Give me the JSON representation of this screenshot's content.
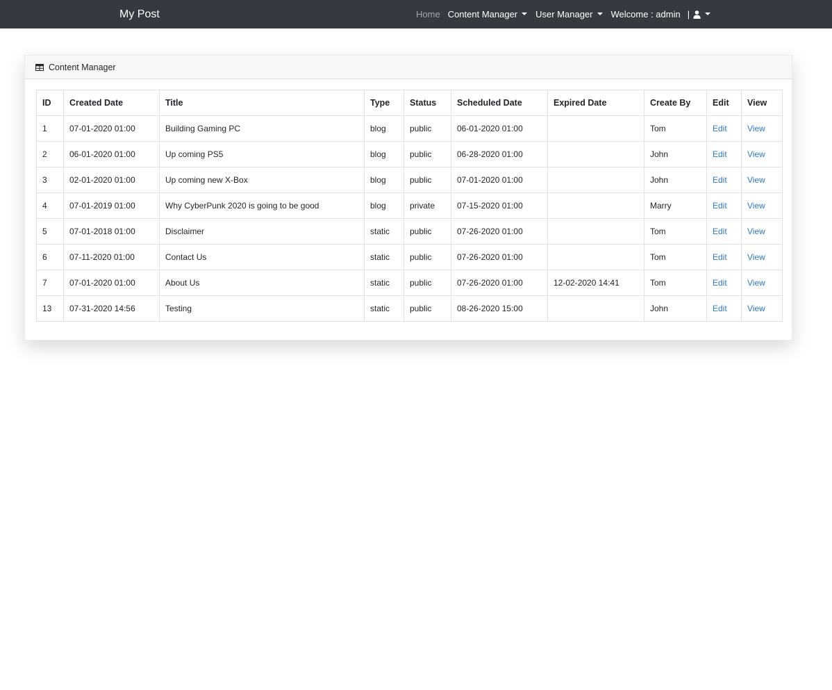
{
  "navbar": {
    "brand": "My Post",
    "home": "Home",
    "content_manager": "Content Manager",
    "user_manager": "User Manager",
    "welcome": "Welcome : admin",
    "separator": "|"
  },
  "card": {
    "title": "Content Manager"
  },
  "table": {
    "columns": [
      "ID",
      "Created Date",
      "Title",
      "Type",
      "Status",
      "Scheduled Date",
      "Expired Date",
      "Create By",
      "Edit",
      "View"
    ],
    "rows": [
      {
        "id": "1",
        "created": "07-01-2020 01:00",
        "title": "Building Gaming PC",
        "type": "blog",
        "status": "public",
        "scheduled": "06-01-2020 01:00",
        "expired": "",
        "by": "Tom",
        "edit": "Edit",
        "view": "View"
      },
      {
        "id": "2",
        "created": "06-01-2020 01:00",
        "title": "Up coming PS5",
        "type": "blog",
        "status": "public",
        "scheduled": "06-28-2020 01:00",
        "expired": "",
        "by": "John",
        "edit": "Edit",
        "view": "View"
      },
      {
        "id": "3",
        "created": "02-01-2020 01:00",
        "title": "Up coming new X-Box",
        "type": "blog",
        "status": "public",
        "scheduled": "07-01-2020 01:00",
        "expired": "",
        "by": "John",
        "edit": "Edit",
        "view": "View"
      },
      {
        "id": "4",
        "created": "07-01-2019 01:00",
        "title": "Why CyberPunk 2020 is going to be good",
        "type": "blog",
        "status": "private",
        "scheduled": "07-15-2020 01:00",
        "expired": "",
        "by": "Marry",
        "edit": "Edit",
        "view": "View"
      },
      {
        "id": "5",
        "created": "07-01-2018 01:00",
        "title": "Disclaimer",
        "type": "static",
        "status": "public",
        "scheduled": "07-26-2020 01:00",
        "expired": "",
        "by": "Tom",
        "edit": "Edit",
        "view": "View"
      },
      {
        "id": "6",
        "created": "07-11-2020 01:00",
        "title": "Contact Us",
        "type": "static",
        "status": "public",
        "scheduled": "07-26-2020 01:00",
        "expired": "",
        "by": "Tom",
        "edit": "Edit",
        "view": "View"
      },
      {
        "id": "7",
        "created": "07-01-2020 01:00",
        "title": "About Us",
        "type": "static",
        "status": "public",
        "scheduled": "07-26-2020 01:00",
        "expired": "12-02-2020 14:41",
        "by": "Tom",
        "edit": "Edit",
        "view": "View"
      },
      {
        "id": "13",
        "created": "07-31-2020 14:56",
        "title": "Testing",
        "type": "static",
        "status": "public",
        "scheduled": "08-26-2020 15:00",
        "expired": "",
        "by": "John",
        "edit": "Edit",
        "view": "View"
      }
    ]
  },
  "colors": {
    "navbar_bg": "#343a40",
    "link": "#2f79c4"
  },
  "icons": {
    "card_header": "table-icon",
    "user_menu": "user-icon"
  }
}
